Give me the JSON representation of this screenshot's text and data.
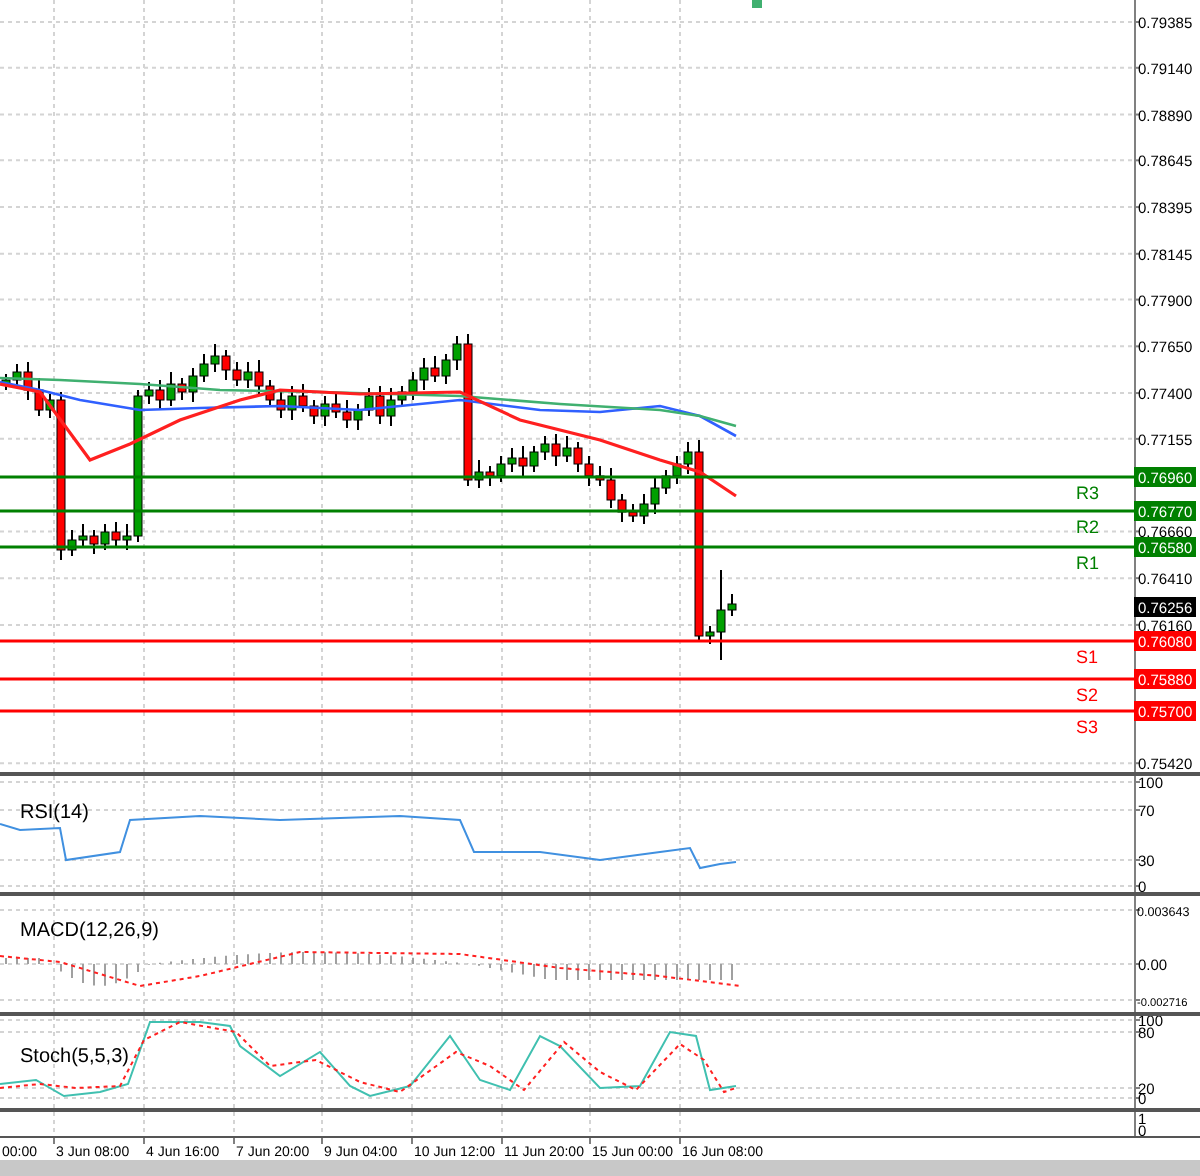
{
  "price_axis": {
    "ticks": [
      "0.79385",
      "0.79140",
      "0.78890",
      "0.78645",
      "0.78395",
      "0.78145",
      "0.77900",
      "0.77650",
      "0.77400",
      "0.77155",
      "0.76660",
      "0.76410",
      "0.76160",
      "0.75420"
    ]
  },
  "levels": [
    {
      "label": "R3",
      "tag": "0.76960",
      "kind": "resistance"
    },
    {
      "label": "R2",
      "tag": "0.76770",
      "kind": "resistance"
    },
    {
      "label": "R1",
      "tag": "0.76580",
      "kind": "resistance"
    },
    {
      "label": "S1",
      "tag": "0.76080",
      "kind": "support"
    },
    {
      "label": "S2",
      "tag": "0.75880",
      "kind": "support"
    },
    {
      "label": "S3",
      "tag": "0.75700",
      "kind": "support"
    }
  ],
  "current_price": {
    "tag": "0.76256"
  },
  "indicators": [
    {
      "kind": "rsi",
      "title": "RSI(14)",
      "ticks": [
        "100",
        "70",
        "30",
        "0"
      ]
    },
    {
      "kind": "macd",
      "title": "MACD(12,26,9)",
      "ticks": [
        "0.003643",
        "0.00",
        "-0.002716"
      ]
    },
    {
      "kind": "stoch",
      "title": "Stoch(5,5,3)",
      "ticks": [
        "100",
        "80",
        "20",
        "0"
      ]
    },
    {
      "kind": "blank",
      "ticks": [
        "1",
        "0"
      ]
    }
  ],
  "time_axis": {
    "labels": [
      "00:00",
      "3 Jun 08:00",
      "4 Jun 16:00",
      "7 Jun 20:00",
      "9 Jun 04:00",
      "10 Jun 12:00",
      "11 Jun 20:00",
      "15 Jun 00:00",
      "16 Jun 08:00"
    ]
  }
}
